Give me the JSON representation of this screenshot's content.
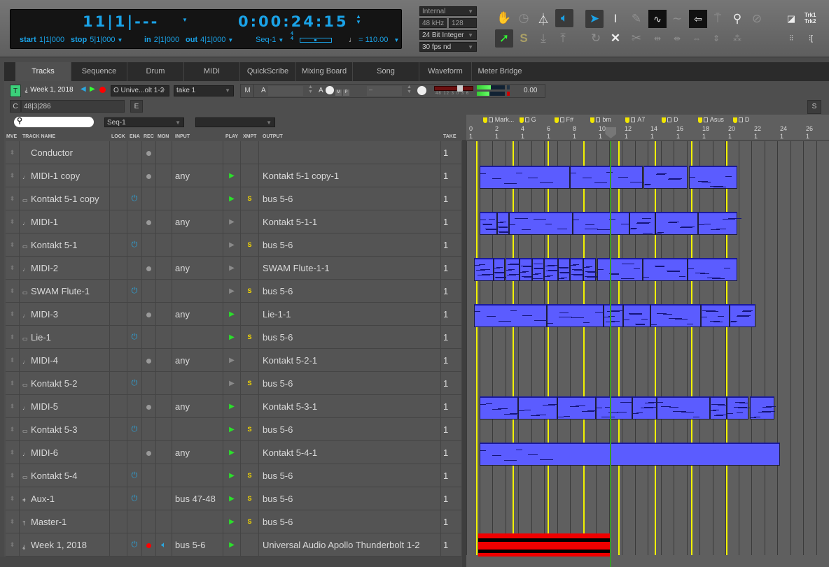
{
  "transport": {
    "counter_bars": "11|1|---",
    "counter_time": "0:00:24:15",
    "start_label": "start",
    "start_value": "1|1|000",
    "stop_label": "stop",
    "stop_value": "5|1|000",
    "in_label": "in",
    "in_value": "2|1|000",
    "out_label": "out",
    "out_value": "4|1|000",
    "sequence": "Seq-1",
    "meter_top": "4",
    "meter_bottom": "4",
    "tempo": "110.00",
    "tempo_prefix": "= "
  },
  "audio_settings": {
    "clock_source": "Internal",
    "sample_rate": "48 kHz",
    "buffer": "128",
    "bit_depth": "24 Bit Integer",
    "frame_rate": "30 fps nd"
  },
  "toolbar": {
    "trk1": "Trk1",
    "trk2": "Trk2",
    "solo_label": "S"
  },
  "tabs": [
    {
      "label": "Tracks",
      "active": true
    },
    {
      "label": "Sequence"
    },
    {
      "label": "Drum"
    },
    {
      "label": "MIDI"
    },
    {
      "label": "QuickScribe"
    },
    {
      "label": "Mixing Board"
    },
    {
      "label": "Song"
    },
    {
      "label": "Waveform"
    },
    {
      "label": "Meter Bridge"
    }
  ],
  "selected_track": {
    "t_label": "T",
    "name": "Week 1, 2018",
    "output": "O Unive...olt 1-2",
    "take": "take 1",
    "m_label": "M",
    "a_label": "A",
    "a2_label": "A",
    "mp_m": "M",
    "mp_p": "P",
    "dash_field": "–",
    "fader_scale": "48 12 3 0 3 6",
    "volume": "0.00",
    "c_label": "C",
    "position": "48|3|286",
    "e_label": "E",
    "side_s": "S"
  },
  "filters": {
    "search_placeholder": "",
    "sequence_select": "Seq-1",
    "second_select": ""
  },
  "columns": {
    "mve": "MVE",
    "track_name": "TRACK NAME",
    "lock": "LOCK",
    "ena": "ENA",
    "rec": "REC",
    "mon": "MON",
    "input": "INPUT",
    "play": "PLAY",
    "xmpt": "XMPT",
    "output": "OUTPUT",
    "take": "TAKE"
  },
  "tracks": [
    {
      "name": "Conductor",
      "type": "conductor",
      "enabled": false,
      "rec": "grey",
      "mon": false,
      "input": "",
      "play": "none",
      "xmpt": false,
      "output": "",
      "take": "1"
    },
    {
      "name": "MIDI-1 copy",
      "type": "midi",
      "enabled": false,
      "rec": "grey",
      "mon": false,
      "input": "any",
      "play": "green",
      "xmpt": false,
      "output": "Kontakt 5-1 copy-1",
      "take": "1"
    },
    {
      "name": "Kontakt 5-1 copy",
      "type": "instrument",
      "enabled": true,
      "rec": "none",
      "mon": false,
      "input": "",
      "play": "green",
      "xmpt": true,
      "output": "bus 5-6",
      "take": "1"
    },
    {
      "name": "MIDI-1",
      "type": "midi",
      "enabled": false,
      "rec": "grey",
      "mon": false,
      "input": "any",
      "play": "grey",
      "xmpt": false,
      "output": "Kontakt 5-1-1",
      "take": "1"
    },
    {
      "name": "Kontakt 5-1",
      "type": "instrument",
      "enabled": true,
      "rec": "none",
      "mon": false,
      "input": "",
      "play": "grey",
      "xmpt": true,
      "output": "bus 5-6",
      "take": "1"
    },
    {
      "name": "MIDI-2",
      "type": "midi",
      "enabled": false,
      "rec": "grey",
      "mon": false,
      "input": "any",
      "play": "grey",
      "xmpt": false,
      "output": "SWAM Flute-1-1",
      "take": "1"
    },
    {
      "name": "SWAM Flute-1",
      "type": "instrument",
      "enabled": true,
      "rec": "none",
      "mon": false,
      "input": "",
      "play": "grey",
      "xmpt": true,
      "output": "bus 5-6",
      "take": "1"
    },
    {
      "name": "MIDI-3",
      "type": "midi",
      "enabled": false,
      "rec": "grey",
      "mon": false,
      "input": "any",
      "play": "green",
      "xmpt": false,
      "output": "Lie-1-1",
      "take": "1"
    },
    {
      "name": "Lie-1",
      "type": "instrument",
      "enabled": true,
      "rec": "none",
      "mon": false,
      "input": "",
      "play": "green",
      "xmpt": true,
      "output": "bus 5-6",
      "take": "1"
    },
    {
      "name": "MIDI-4",
      "type": "midi",
      "enabled": false,
      "rec": "grey",
      "mon": false,
      "input": "any",
      "play": "grey",
      "xmpt": false,
      "output": "Kontakt 5-2-1",
      "take": "1"
    },
    {
      "name": "Kontakt 5-2",
      "type": "instrument",
      "enabled": true,
      "rec": "none",
      "mon": false,
      "input": "",
      "play": "grey",
      "xmpt": true,
      "output": "bus 5-6",
      "take": "1"
    },
    {
      "name": "MIDI-5",
      "type": "midi",
      "enabled": false,
      "rec": "grey",
      "mon": false,
      "input": "any",
      "play": "green",
      "xmpt": false,
      "output": "Kontakt 5-3-1",
      "take": "1"
    },
    {
      "name": "Kontakt 5-3",
      "type": "instrument",
      "enabled": true,
      "rec": "none",
      "mon": false,
      "input": "",
      "play": "green",
      "xmpt": true,
      "output": "bus 5-6",
      "take": "1"
    },
    {
      "name": "MIDI-6",
      "type": "midi",
      "enabled": false,
      "rec": "grey",
      "mon": false,
      "input": "any",
      "play": "green",
      "xmpt": false,
      "output": "Kontakt 5-4-1",
      "take": "1"
    },
    {
      "name": "Kontakt 5-4",
      "type": "instrument",
      "enabled": true,
      "rec": "none",
      "mon": false,
      "input": "",
      "play": "green",
      "xmpt": true,
      "output": "bus 5-6",
      "take": "1"
    },
    {
      "name": "Aux-1",
      "type": "aux",
      "enabled": true,
      "rec": "none",
      "mon": false,
      "input": "bus 47-48",
      "play": "green",
      "xmpt": true,
      "output": "bus 5-6",
      "take": "1"
    },
    {
      "name": "Master-1",
      "type": "master",
      "enabled": false,
      "rec": "none",
      "mon": false,
      "input": "",
      "play": "green",
      "xmpt": true,
      "output": "bus 5-6",
      "take": "1"
    },
    {
      "name": "Week 1, 2018",
      "type": "audio",
      "enabled": true,
      "rec": "red",
      "mon": true,
      "input": "bus 5-6",
      "play": "green",
      "xmpt": false,
      "output": "Universal Audio Apollo Thunderbolt 1-2",
      "take": "1"
    }
  ],
  "timeline": {
    "ruler_bars": [
      "0",
      "2",
      "4",
      "6",
      "8",
      "10",
      "12",
      "14",
      "16",
      "18",
      "20",
      "22",
      "24",
      "26"
    ],
    "ruler_beat": "1",
    "playhead_bar": 11.1,
    "markers": [
      {
        "label": "Mark...",
        "bar": 0.8
      },
      {
        "label": "G",
        "bar": 3.6
      },
      {
        "label": "F#",
        "bar": 6.3
      },
      {
        "label": "bm",
        "bar": 9.1
      },
      {
        "label": "A7",
        "bar": 11.8
      },
      {
        "label": "D",
        "bar": 14.6
      },
      {
        "label": "Asus",
        "bar": 17.4
      },
      {
        "label": "D",
        "bar": 20.1
      }
    ],
    "clips": [
      {
        "track": 1,
        "kind": "midi",
        "segments": [
          [
            1,
            8
          ],
          [
            8,
            13.6
          ],
          [
            13.7,
            17.1
          ],
          [
            17.2,
            20.9
          ]
        ]
      },
      {
        "track": 3,
        "kind": "midi",
        "segments": [
          [
            1,
            2.4
          ],
          [
            2.4,
            3.3
          ],
          [
            3.3,
            8.2
          ],
          [
            8.2,
            12.6
          ],
          [
            12.6,
            14.6
          ],
          [
            14.6,
            17.9
          ],
          [
            17.9,
            20.9
          ]
        ]
      },
      {
        "track": 5,
        "kind": "midi",
        "segments": [
          [
            0.6,
            2.1
          ],
          [
            2.1,
            3.0
          ],
          [
            3.0,
            4.1
          ],
          [
            4.1,
            5.1
          ],
          [
            5.1,
            6.0
          ],
          [
            6.0,
            7.1
          ],
          [
            7.1,
            8.0
          ],
          [
            8.0,
            9.0
          ],
          [
            9.0,
            10.0
          ],
          [
            10.1,
            13.6
          ],
          [
            13.6,
            17.1
          ],
          [
            17.1,
            20.9
          ]
        ]
      },
      {
        "track": 7,
        "kind": "midi",
        "segments": [
          [
            0.6,
            6.2
          ],
          [
            6.2,
            10.6
          ],
          [
            10.6,
            12.1
          ],
          [
            12.1,
            14.2
          ],
          [
            14.2,
            18.1
          ],
          [
            18.1,
            20.3
          ],
          [
            20.3,
            22.3
          ]
        ]
      },
      {
        "track": 11,
        "kind": "midi",
        "segments": [
          [
            1,
            4
          ],
          [
            4,
            7
          ],
          [
            7,
            10
          ],
          [
            10,
            12.8
          ],
          [
            12.8,
            14.7
          ],
          [
            14.7,
            18.8
          ],
          [
            18.8,
            20.1
          ],
          [
            20.1,
            21.8
          ],
          [
            21.9,
            23.8
          ]
        ]
      },
      {
        "track": 13,
        "kind": "midi",
        "segments": [
          [
            1,
            24.2
          ]
        ]
      },
      {
        "track": 17,
        "kind": "audio",
        "segments": [
          [
            0.9,
            11.1
          ]
        ]
      }
    ]
  }
}
